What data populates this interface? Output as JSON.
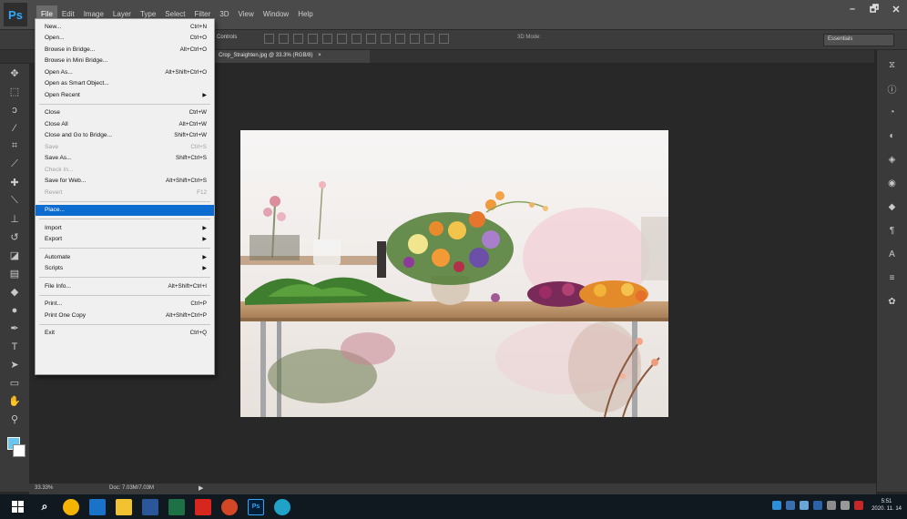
{
  "app": {
    "logo": "Ps"
  },
  "menubar": {
    "items": [
      "File",
      "Edit",
      "Image",
      "Layer",
      "Type",
      "Select",
      "Filter",
      "3D",
      "View",
      "Window",
      "Help"
    ],
    "window_controls": [
      "–",
      "🗗",
      "✕"
    ]
  },
  "options_bar": {
    "label": "Controls",
    "mode_3d": "3D Mode:",
    "workspace": "Essentials"
  },
  "document": {
    "tab_title": "Crop_Straighten.jpg @ 33.3% (RGB/8)",
    "tab_close": "×"
  },
  "file_menu": {
    "groups": [
      [
        {
          "label": "New...",
          "shortcut": "Ctrl+N"
        },
        {
          "label": "Open...",
          "shortcut": "Ctrl+O"
        },
        {
          "label": "Browse in Bridge...",
          "shortcut": "Alt+Ctrl+O"
        },
        {
          "label": "Browse in Mini Bridge...",
          "shortcut": ""
        },
        {
          "label": "Open As...",
          "shortcut": "Alt+Shift+Ctrl+O"
        },
        {
          "label": "Open as Smart Object...",
          "shortcut": ""
        },
        {
          "label": "Open Recent",
          "shortcut": "",
          "submenu": true
        }
      ],
      [
        {
          "label": "Close",
          "shortcut": "Ctrl+W"
        },
        {
          "label": "Close All",
          "shortcut": "Alt+Ctrl+W"
        },
        {
          "label": "Close and Go to Bridge...",
          "shortcut": "Shift+Ctrl+W"
        },
        {
          "label": "Save",
          "shortcut": "Ctrl+S",
          "disabled": true
        },
        {
          "label": "Save As...",
          "shortcut": "Shift+Ctrl+S"
        },
        {
          "label": "Check In...",
          "shortcut": "",
          "disabled": true
        },
        {
          "label": "Save for Web...",
          "shortcut": "Alt+Shift+Ctrl+S"
        },
        {
          "label": "Revert",
          "shortcut": "F12",
          "disabled": true
        }
      ],
      [
        {
          "label": "Place...",
          "shortcut": "",
          "highlight": true
        }
      ],
      [
        {
          "label": "Import",
          "shortcut": "",
          "submenu": true
        },
        {
          "label": "Export",
          "shortcut": "",
          "submenu": true
        }
      ],
      [
        {
          "label": "Automate",
          "shortcut": "",
          "submenu": true
        },
        {
          "label": "Scripts",
          "shortcut": "",
          "submenu": true
        }
      ],
      [
        {
          "label": "File Info...",
          "shortcut": "Alt+Shift+Ctrl+I"
        }
      ],
      [
        {
          "label": "Print...",
          "shortcut": "Ctrl+P"
        },
        {
          "label": "Print One Copy",
          "shortcut": "Alt+Shift+Ctrl+P"
        }
      ],
      [
        {
          "label": "Exit",
          "shortcut": "Ctrl+Q"
        }
      ]
    ]
  },
  "statusbar": {
    "zoom": "33.33%",
    "doc": "Doc: 7.03M/7.03M",
    "arrow": "▶"
  },
  "taskbar": {
    "clock_time": "5:51",
    "clock_date": "2020. 11. 14"
  },
  "colors": {
    "menubar_bg": "#4a4a4a",
    "workspace_bg": "#282828",
    "menu_highlight": "#0d6ccf",
    "foreground_color": "#6ac6ee",
    "background_color": "#ffffff",
    "taskbar_bg": "#101820"
  },
  "icons": {
    "toolbar": [
      "move-icon",
      "marquee-icon",
      "lasso-icon",
      "quick-select-icon",
      "crop-icon",
      "eyedropper-icon",
      "healing-icon",
      "brush-icon",
      "stamp-icon",
      "history-brush-icon",
      "eraser-icon",
      "gradient-icon",
      "blur-icon",
      "dodge-icon",
      "pen-icon",
      "type-icon",
      "path-select-icon",
      "shape-icon",
      "hand-icon",
      "zoom-icon"
    ],
    "right_panel": [
      "history-icon",
      "info-icon",
      "properties-icon",
      "adjustments-icon",
      "layers-icon",
      "color-icon",
      "swatches-icon",
      "paragraph-icon",
      "character-icon",
      "channels-icon",
      "paths-icon"
    ]
  }
}
